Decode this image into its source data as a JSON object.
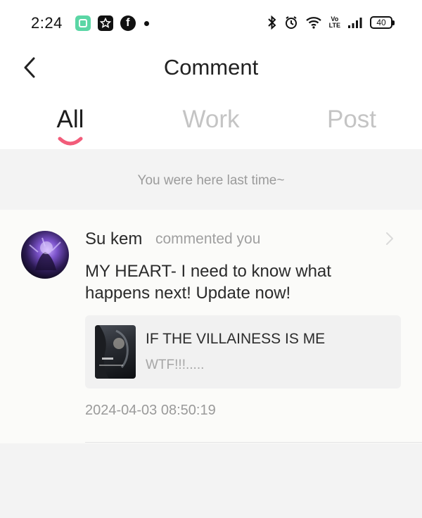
{
  "status_bar": {
    "time": "2:24",
    "battery": "40",
    "volte": [
      "Vo",
      "LTE"
    ],
    "icons": [
      "app-icon-green",
      "app-icon-star",
      "facebook-icon",
      "notification-dot",
      "bluetooth-icon",
      "alarm-icon",
      "wifi-icon",
      "volte-icon",
      "signal-icon",
      "battery-icon"
    ]
  },
  "header": {
    "title": "Comment",
    "back_icon": "chevron-left-icon"
  },
  "tabs": [
    {
      "label": "All",
      "active": true
    },
    {
      "label": "Work",
      "active": false
    },
    {
      "label": "Post",
      "active": false
    }
  ],
  "hint": "You were here last time~",
  "comment": {
    "username": "Su kem",
    "action": "commented you",
    "body": "MY HEART- I need to know what happens next! Update now!",
    "work": {
      "title": "IF THE VILLAINESS IS ME",
      "snippet": "WTF!!!....."
    },
    "timestamp": "2024-04-03 08:50:19"
  },
  "colors": {
    "accent": "#f25c7a",
    "page_bg": "#f3f3f3",
    "card_bg": "#fbfbf9"
  }
}
